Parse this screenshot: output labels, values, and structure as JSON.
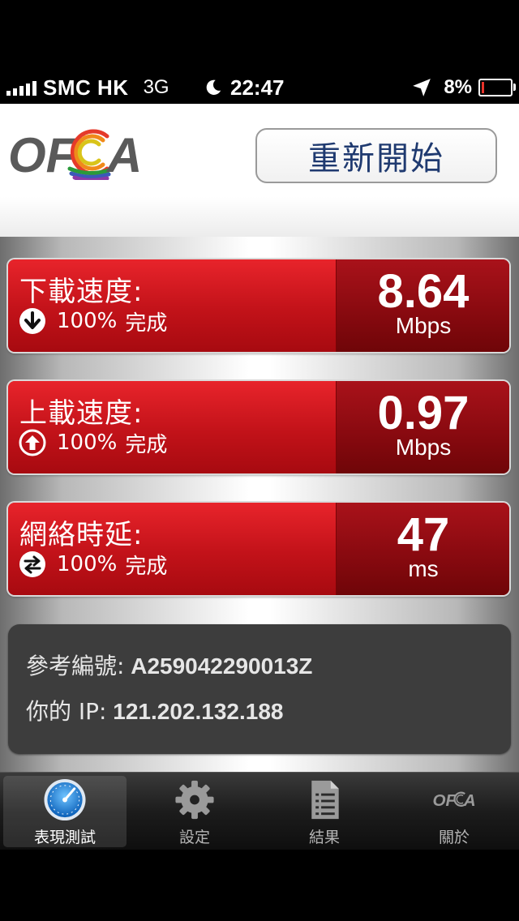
{
  "status_bar": {
    "carrier": "SMC HK",
    "network": "3G",
    "time": "22:47",
    "battery_percent": "8%",
    "battery_level": 0.08
  },
  "header": {
    "logo_text": "OFCA",
    "restart_label": "重新開始"
  },
  "metrics": [
    {
      "label": "下載速度:",
      "status_percent": "100%",
      "status_text": "完成",
      "value": "8.64",
      "unit": "Mbps",
      "icon": "arrow-down-circle-icon"
    },
    {
      "label": "上載速度:",
      "status_percent": "100%",
      "status_text": "完成",
      "value": "0.97",
      "unit": "Mbps",
      "icon": "arrow-up-circle-icon"
    },
    {
      "label": "網絡時延:",
      "status_percent": "100%",
      "status_text": "完成",
      "value": "47",
      "unit": "ms",
      "icon": "swap-arrows-circle-icon"
    }
  ],
  "info": {
    "ref_label": "參考編號:",
    "ref_value": "A259042290013Z",
    "ip_label": "你的 IP:",
    "ip_value": "121.202.132.188"
  },
  "tabs": [
    {
      "label": "表現測試",
      "icon": "speedometer-icon",
      "active": true
    },
    {
      "label": "設定",
      "icon": "gear-icon",
      "active": false
    },
    {
      "label": "結果",
      "icon": "document-list-icon",
      "active": false
    },
    {
      "label": "關於",
      "icon": "ofca-logo-icon",
      "active": false
    }
  ],
  "colors": {
    "metric_red": "#c21219",
    "metric_dark_red": "#8a0a10",
    "button_text": "#1f3a70",
    "info_bg": "#3d3d3d"
  }
}
